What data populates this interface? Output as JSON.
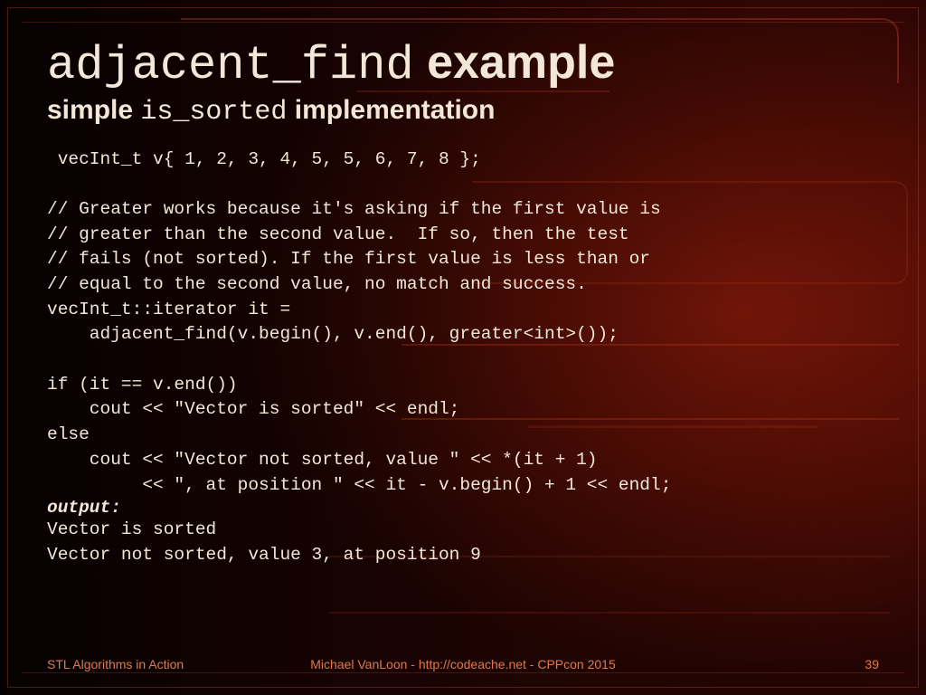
{
  "title": {
    "mono": "adjacent_find",
    "plain": " example"
  },
  "subtitle": {
    "pre": "simple ",
    "mono": "is_sorted",
    "post": " implementation"
  },
  "code": " vecInt_t v{ 1, 2, 3, 4, 5, 5, 6, 7, 8 };\n\n// Greater works because it's asking if the first value is\n// greater than the second value.  If so, then the test\n// fails (not sorted). If the first value is less than or\n// equal to the second value, no match and success.\nvecInt_t::iterator it =\n    adjacent_find(v.begin(), v.end(), greater<int>());\n\nif (it == v.end())\n    cout << \"Vector is sorted\" << endl;\nelse\n    cout << \"Vector not sorted, value \" << *(it + 1)\n         << \", at position \" << it - v.begin() + 1 << endl;\n",
  "output_label": "output:",
  "output": "Vector is sorted\nVector not sorted, value 3, at position 9",
  "footer": {
    "left": "STL Algorithms in Action",
    "center": "Michael VanLoon - http://codeache.net - CPPcon 2015",
    "right": "39"
  }
}
